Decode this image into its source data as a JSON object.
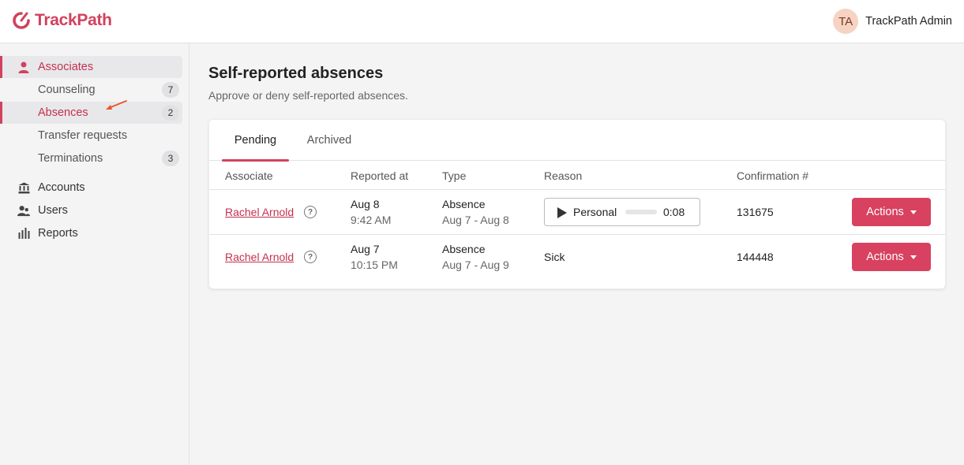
{
  "app": {
    "name": "TrackPath",
    "brand_color": "#d2415e"
  },
  "user": {
    "initials": "TA",
    "name": "TrackPath Admin"
  },
  "sidebar": {
    "items": [
      {
        "label": "Associates",
        "icon": "person-icon"
      },
      {
        "label": "Counseling",
        "count": "7"
      },
      {
        "label": "Absences",
        "count": "2"
      },
      {
        "label": "Transfer requests"
      },
      {
        "label": "Terminations",
        "count": "3"
      },
      {
        "label": "Accounts",
        "icon": "bank-icon"
      },
      {
        "label": "Users",
        "icon": "users-icon"
      },
      {
        "label": "Reports",
        "icon": "bar-chart-icon"
      }
    ]
  },
  "page": {
    "title": "Self-reported absences",
    "subtitle": "Approve or deny self-reported absences."
  },
  "tabs": [
    {
      "label": "Pending",
      "active": true
    },
    {
      "label": "Archived",
      "active": false
    }
  ],
  "table": {
    "headers": [
      "Associate",
      "Reported at",
      "Type",
      "Reason",
      "Confirmation #"
    ],
    "rows": [
      {
        "associate": "Rachel Arnold",
        "reported_date": "Aug 8",
        "reported_time": "9:42 AM",
        "type": "Absence",
        "range": "Aug 7 - Aug 8",
        "reason": "Personal",
        "reason_audio": true,
        "audio_duration": "0:08",
        "audio_progress": 0,
        "confirmation": "131675",
        "action_label": "Actions"
      },
      {
        "associate": "Rachel Arnold",
        "reported_date": "Aug 7",
        "reported_time": "10:15 PM",
        "type": "Absence",
        "range": "Aug 7 - Aug 9",
        "reason": "Sick",
        "reason_audio": false,
        "confirmation": "144448",
        "action_label": "Actions"
      }
    ]
  }
}
